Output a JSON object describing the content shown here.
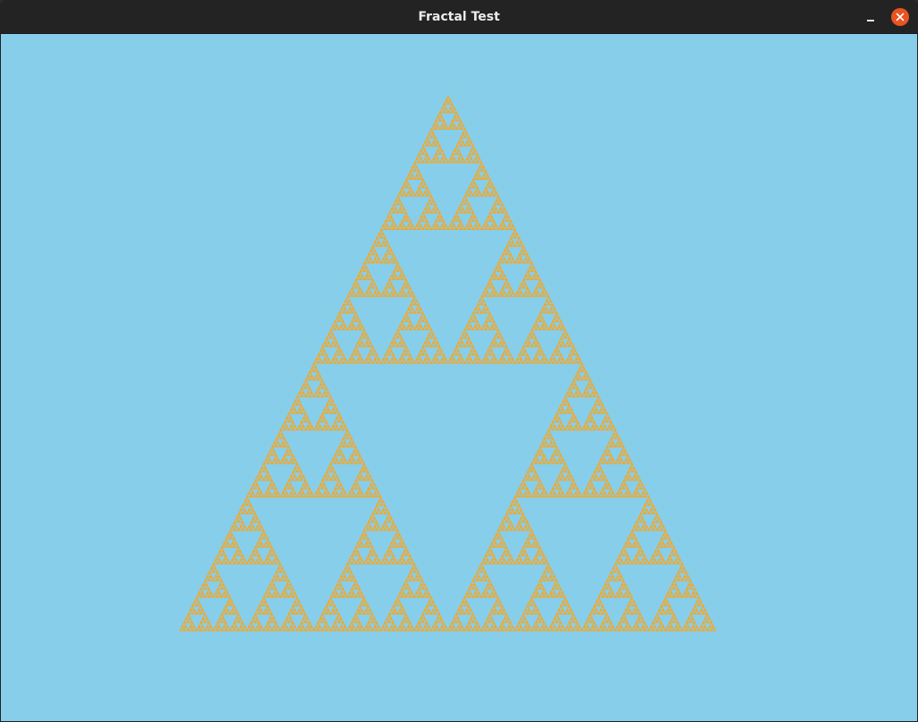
{
  "window": {
    "title": "Fractal Test"
  },
  "icons": {
    "minimize": "minimize-icon",
    "close": "close-icon"
  },
  "colors": {
    "titlebar_bg": "#232323",
    "title_text": "#ececec",
    "close_button": "#e95420",
    "canvas_bg": "#87ceeb",
    "fractal_stroke": "#f5a623"
  },
  "fractal": {
    "type": "sierpinski-triangle",
    "depth": 7
  }
}
